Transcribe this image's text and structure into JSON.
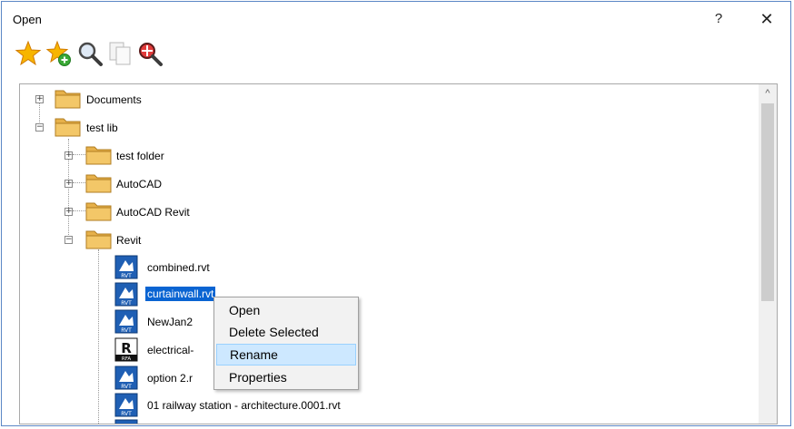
{
  "window": {
    "title": "Open",
    "help_label": "?",
    "close_label": "✕"
  },
  "toolbar": {
    "items": [
      {
        "icon": "favorite-star-icon"
      },
      {
        "icon": "add-favorite-icon"
      },
      {
        "icon": "search-icon"
      },
      {
        "icon": "copy-pages-icon"
      },
      {
        "icon": "zoom-target-icon"
      }
    ]
  },
  "tree": {
    "nodes": [
      {
        "label": "Documents",
        "type": "folder",
        "expander": "+"
      },
      {
        "label": "test lib",
        "type": "folder",
        "expander": "−"
      },
      {
        "label": "test folder",
        "type": "folder",
        "expander": "+"
      },
      {
        "label": "AutoCAD",
        "type": "folder",
        "expander": "+"
      },
      {
        "label": "AutoCAD Revit",
        "type": "folder",
        "expander": "+"
      },
      {
        "label": "Revit",
        "type": "folder",
        "expander": "−"
      },
      {
        "label": "combined.rvt",
        "type": "rvt"
      },
      {
        "label": "curtainwall.rvt",
        "type": "rvt",
        "selected": true
      },
      {
        "label": "NewJan2",
        "type": "rvt"
      },
      {
        "label": "electrical-",
        "type": "rfa"
      },
      {
        "label": "option 2.r",
        "type": "rvt"
      },
      {
        "label": "01 railway station - architecture.0001.rvt",
        "type": "rvt"
      }
    ]
  },
  "scrollbar": {
    "up_arrow": "^"
  },
  "context_menu": {
    "items": [
      {
        "label": "Open"
      },
      {
        "label": "Delete Selected"
      },
      {
        "label": "Rename",
        "highlighted": true
      },
      {
        "label": "Properties"
      }
    ]
  },
  "colors": {
    "selection": "#0a64d2",
    "menu_highlight": "#cde8ff",
    "window_border": "#5b87c5"
  }
}
